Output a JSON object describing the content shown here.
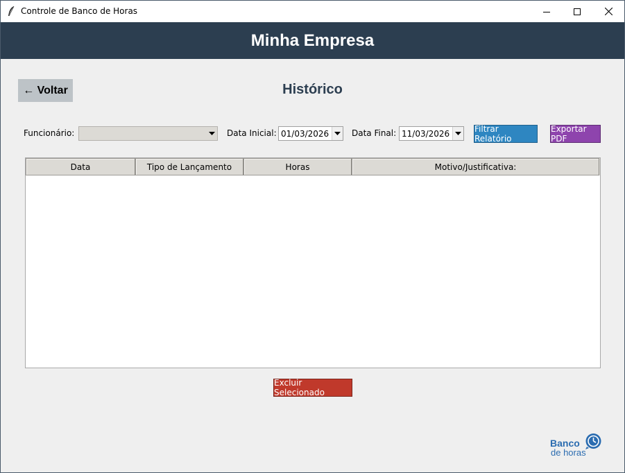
{
  "window": {
    "title": "Controle de Banco de Horas",
    "minimize_icon": "minimize-icon",
    "maximize_icon": "maximize-icon",
    "close_icon": "close-icon"
  },
  "header": {
    "title": "Minha Empresa"
  },
  "back_button": {
    "label": "← Voltar"
  },
  "page": {
    "title": "Histórico"
  },
  "filters": {
    "employee_label": "Funcionário:",
    "employee_value": "",
    "start_label": "Data Inicial:",
    "start_value": "01/03/2026",
    "end_label": "Data Final:",
    "end_value": "11/03/2026",
    "filter_button": "Filtrar Relatório",
    "export_button": "Exportar PDF"
  },
  "table": {
    "columns": [
      "Data",
      "Tipo de Lançamento",
      "Horas",
      "Motivo/Justificativa:"
    ],
    "rows": []
  },
  "delete_button": "Excluir Selecionado",
  "logo": {
    "line1": "Banco",
    "line2": "de horas"
  },
  "colors": {
    "header_bg": "#2c3e50",
    "filter_button": "#2e86c1",
    "export_button": "#8e44ad",
    "delete_button": "#c0392b",
    "back_button": "#bdc3c7",
    "logo": "#2b6cb0"
  }
}
